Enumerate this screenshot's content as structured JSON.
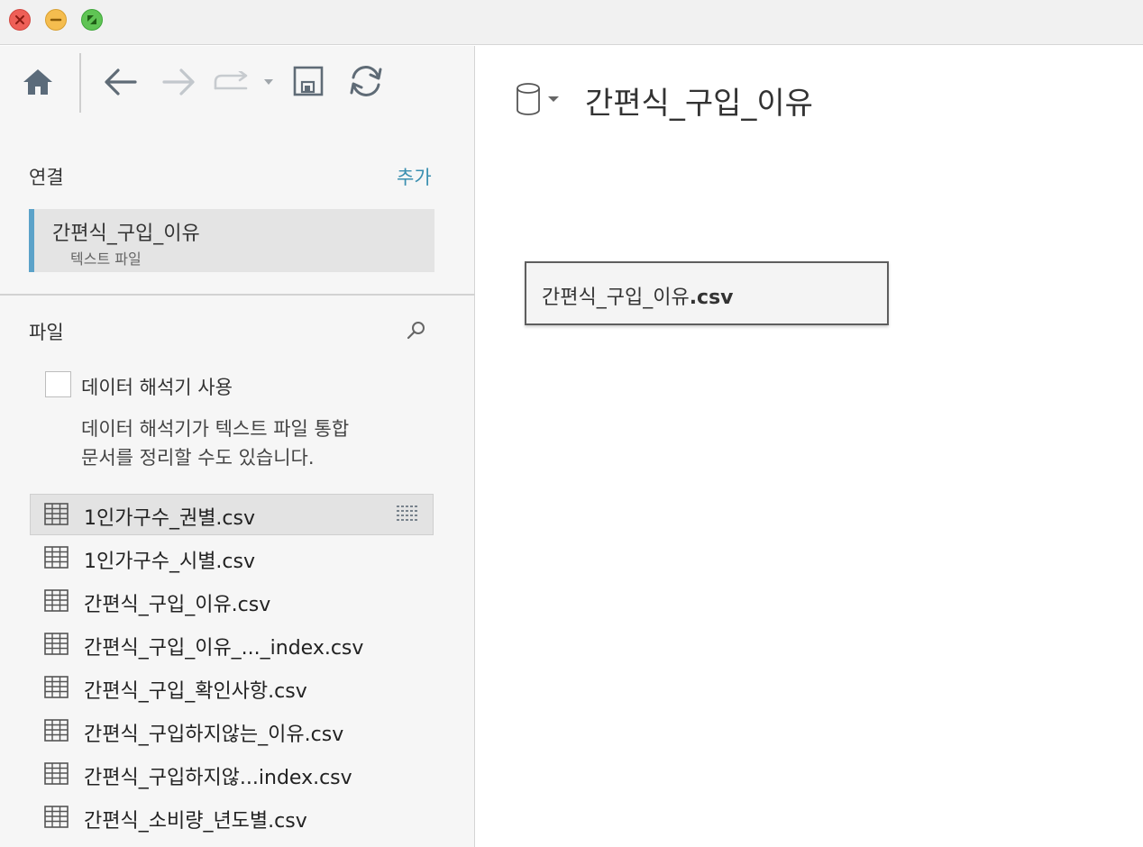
{
  "window": {
    "controls": [
      "close",
      "minimize",
      "maximize"
    ]
  },
  "toolbar": {
    "icons": [
      "home-icon",
      "back-icon",
      "forward-icon",
      "redo-icon",
      "save-icon",
      "refresh-icon"
    ]
  },
  "connections": {
    "header": "연결",
    "add_label": "추가",
    "items": [
      {
        "name": "간편식_구입_이유",
        "type": "텍스트 파일"
      }
    ]
  },
  "files": {
    "header": "파일",
    "interpreter_label": "데이터 해석기 사용",
    "interpreter_desc_line1": "데이터 해석기가 텍스트 파일 통합",
    "interpreter_desc_line2": "문서를 정리할 수도 있습니다.",
    "items": [
      {
        "name": "1인가구수_권별.csv",
        "selected": true
      },
      {
        "name": "1인가구수_시별.csv"
      },
      {
        "name": "간편식_구입_이유.csv"
      },
      {
        "name": "간편식_구입_이유_..._index.csv"
      },
      {
        "name": "간편식_구입_확인사항.csv"
      },
      {
        "name": "간편식_구입하지않는_이유.csv"
      },
      {
        "name": "간편식_구입하지않...index.csv"
      },
      {
        "name": "간편식_소비량_년도별.csv"
      }
    ]
  },
  "main": {
    "datasource_title": "간편식_구입_이유",
    "table_card": {
      "base": "간편식_구입_이유",
      "ext": ".csv"
    }
  },
  "colors": {
    "accent": "#3a8fb0",
    "connection_bar": "#5ba2c9"
  }
}
